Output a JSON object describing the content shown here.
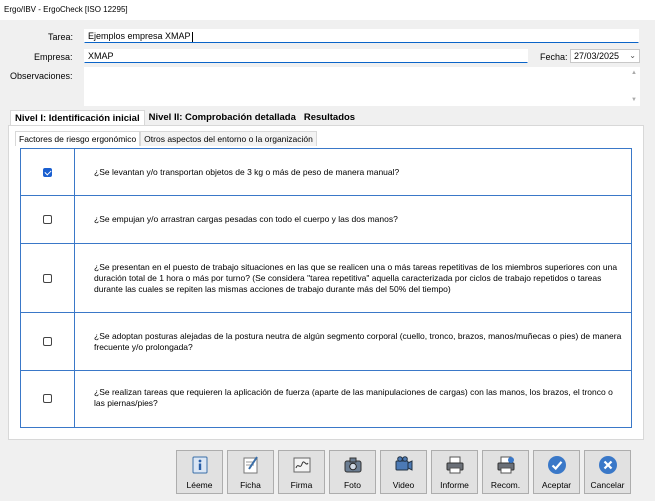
{
  "window": {
    "title": "Ergo/IBV - ErgoCheck [ISO 12295]"
  },
  "form": {
    "tarea_label": "Tarea:",
    "tarea_value": "Ejemplos empresa XMAP",
    "empresa_label": "Empresa:",
    "empresa_value": "XMAP",
    "fecha_label": "Fecha:",
    "fecha_value": "27/03/2025",
    "observaciones_label": "Observaciones:",
    "observaciones_value": ""
  },
  "main_tabs": [
    {
      "label": "Nivel I: Identificación inicial",
      "active": true
    },
    {
      "label": "Nivel II: Comprobación detallada",
      "active": false
    },
    {
      "label": "Resultados",
      "active": false
    }
  ],
  "sub_tabs": [
    {
      "label": "Factores de riesgo ergonómico",
      "active": true
    },
    {
      "label": "Otros aspectos del entorno o la organización",
      "active": false
    }
  ],
  "questions": [
    {
      "text": "¿Se levantan y/o transportan objetos de 3 kg o más de peso de manera manual?",
      "checked": true
    },
    {
      "text": "¿Se empujan y/o arrastran cargas pesadas con todo el cuerpo y las dos manos?",
      "checked": false
    },
    {
      "text": "¿Se presentan en el puesto de trabajo situaciones en las que se realicen una o más tareas repetitivas de los miembros superiores con una duración total de 1 hora o más por turno? (Se considera \"tarea repetitiva\" aquella caracterizada por ciclos de trabajo repetidos o tareas durante las cuales se repiten las mismas acciones de trabajo durante más del 50% del tiempo)",
      "checked": false
    },
    {
      "text": "¿Se adoptan posturas alejadas de la postura neutra de algún segmento corporal (cuello, tronco, brazos, manos/muñecas o pies) de manera frecuente y/o prolongada?",
      "checked": false
    },
    {
      "text": "¿Se realizan tareas que requieren la aplicación de fuerza (aparte de las manipulaciones de cargas) con las manos, los brazos, el tronco o las piernas/pies?",
      "checked": false
    }
  ],
  "buttons": [
    {
      "label": "Léeme",
      "icon": "info-icon"
    },
    {
      "label": "Ficha",
      "icon": "edit-icon"
    },
    {
      "label": "Firma",
      "icon": "signature-icon"
    },
    {
      "label": "Foto",
      "icon": "camera-icon"
    },
    {
      "label": "Video",
      "icon": "video-icon"
    },
    {
      "label": "Informe",
      "icon": "printer-icon"
    },
    {
      "label": "Recom.",
      "icon": "recommendations-icon"
    },
    {
      "label": "Aceptar",
      "icon": "check-icon"
    },
    {
      "label": "Cancelar",
      "icon": "close-icon"
    }
  ],
  "colors": {
    "accent": "#1a5fd0",
    "grid_border": "#3a78c8",
    "cancel": "#3a78c8"
  }
}
